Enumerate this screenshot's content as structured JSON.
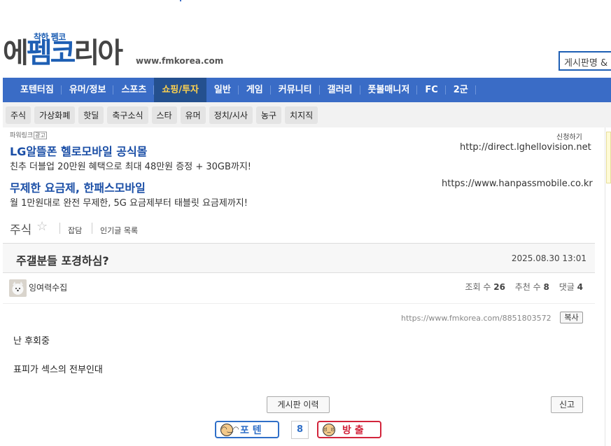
{
  "header": {
    "logo_small": "착한 펨코",
    "logo_part1": "에",
    "logo_part2": "펨코",
    "logo_part3": "리아",
    "domain": "www.fmkorea.com",
    "search_placeholder": "게시판명 &"
  },
  "main_nav": [
    {
      "label": "포텐터짐",
      "active": false
    },
    {
      "label": "유머/정보",
      "active": false
    },
    {
      "label": "스포츠",
      "active": false
    },
    {
      "label": "쇼핑/투자",
      "active": true
    },
    {
      "label": "일반",
      "active": false
    },
    {
      "label": "게임",
      "active": false
    },
    {
      "label": "커뮤니티",
      "active": false
    },
    {
      "label": "갤러리",
      "active": false
    },
    {
      "label": "풋볼매니저",
      "active": false
    },
    {
      "label": "FC",
      "active": false
    },
    {
      "label": "2군",
      "active": false
    }
  ],
  "sub_nav": [
    "주식",
    "가상화폐",
    "핫딜",
    "축구소식",
    "스타",
    "유머",
    "정치/시사",
    "농구",
    "치지직"
  ],
  "ads": {
    "label": "파워링크",
    "tag": "광고",
    "apply": "신청하기",
    "items": [
      {
        "title": "LG알뜰폰 헬로모바일 공식몰",
        "url": "http://direct.lghellovision.net",
        "desc": "친추 더블업 20만원 혜택으로 최대 48만원 증정 + 30GB까지!"
      },
      {
        "title": "무제한 요금제, 한패스모바일",
        "url": "https://www.hanpassmobile.co.kr",
        "desc": "월 1만원대로 완전 무제한, 5G 요금제부터 태블릿 요금제까지!"
      }
    ]
  },
  "board": {
    "name": "주식",
    "star": "☆",
    "link_chat": "잡담",
    "link_popular": "인기글 목록"
  },
  "post": {
    "title": "주갤분들 포경하심?",
    "date": "2025.08.30 13:01",
    "author": "잉여력수집",
    "views_label": "조회 수",
    "views": "26",
    "recommend_label": "추천 수",
    "recommend": "8",
    "comments_label": "댓글",
    "comments": "4",
    "permalink": "https://www.fmkorea.com/8851803572",
    "copy_label": "복사",
    "body_lines": [
      "난 후회중",
      "표피가 섹스의 전부인대"
    ]
  },
  "actions": {
    "history_label": "게시판 이력",
    "report_label": "신고",
    "vote_up_label": "포 텐",
    "vote_count": "8",
    "vote_down_label": "방 출"
  }
}
